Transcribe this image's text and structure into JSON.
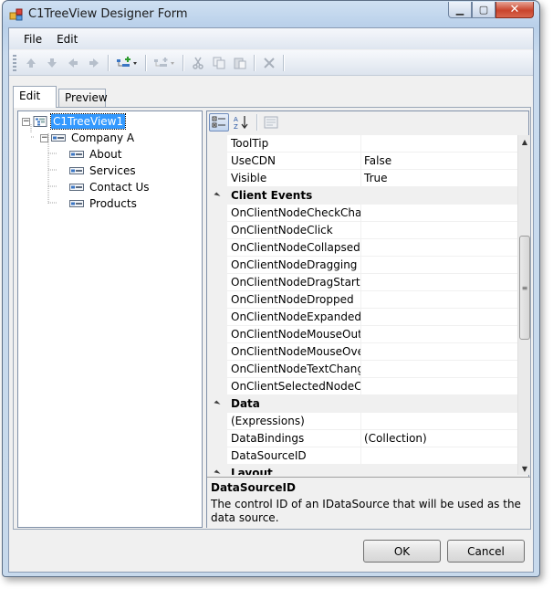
{
  "window": {
    "title": "C1TreeView Designer Form"
  },
  "menu": {
    "items": [
      "File",
      "Edit"
    ]
  },
  "tabs": [
    {
      "label": "Edit",
      "active": true
    },
    {
      "label": "Preview",
      "active": false
    }
  ],
  "tree": {
    "nodes": [
      {
        "label": "C1TreeView1",
        "selected": true
      },
      {
        "label": "Company A",
        "selected": false
      },
      {
        "label": "About",
        "selected": false
      },
      {
        "label": "Services",
        "selected": false
      },
      {
        "label": "Contact Us",
        "selected": false
      },
      {
        "label": "Products",
        "selected": false
      }
    ]
  },
  "properties": {
    "rows": [
      {
        "kind": "prop",
        "name": "ToolTip",
        "value": ""
      },
      {
        "kind": "prop",
        "name": "UseCDN",
        "value": "False"
      },
      {
        "kind": "prop",
        "name": "Visible",
        "value": "True"
      },
      {
        "kind": "category",
        "name": "Client Events"
      },
      {
        "kind": "prop",
        "name": "OnClientNodeCheckChang",
        "value": ""
      },
      {
        "kind": "prop",
        "name": "OnClientNodeClick",
        "value": ""
      },
      {
        "kind": "prop",
        "name": "OnClientNodeCollapsed",
        "value": ""
      },
      {
        "kind": "prop",
        "name": "OnClientNodeDragging",
        "value": ""
      },
      {
        "kind": "prop",
        "name": "OnClientNodeDragStarted",
        "value": ""
      },
      {
        "kind": "prop",
        "name": "OnClientNodeDropped",
        "value": ""
      },
      {
        "kind": "prop",
        "name": "OnClientNodeExpanded",
        "value": ""
      },
      {
        "kind": "prop",
        "name": "OnClientNodeMouseOut",
        "value": ""
      },
      {
        "kind": "prop",
        "name": "OnClientNodeMouseOver",
        "value": ""
      },
      {
        "kind": "prop",
        "name": "OnClientNodeTextChangec",
        "value": ""
      },
      {
        "kind": "prop",
        "name": "OnClientSelectedNodeChar",
        "value": ""
      },
      {
        "kind": "category",
        "name": "Data"
      },
      {
        "kind": "prop",
        "name": "(Expressions)",
        "value": ""
      },
      {
        "kind": "prop",
        "name": "DataBindings",
        "value": "(Collection)"
      },
      {
        "kind": "prop",
        "name": "DataSourceID",
        "value": ""
      },
      {
        "kind": "category",
        "name": "Layout"
      }
    ],
    "help_title": "DataSourceID",
    "help_desc": "The control ID of an IDataSource that will be used as the data source."
  },
  "buttons": {
    "ok": "OK",
    "cancel": "Cancel"
  }
}
